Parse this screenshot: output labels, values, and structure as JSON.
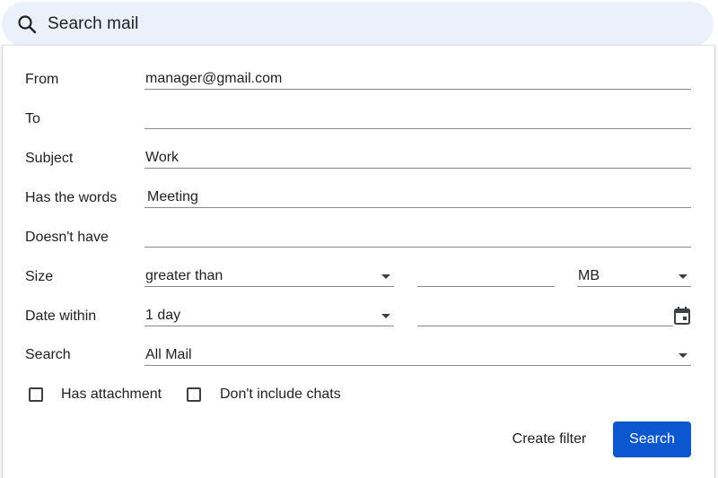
{
  "search": {
    "placeholder": "Search mail"
  },
  "form": {
    "from": {
      "label": "From",
      "value": "manager@gmail.com"
    },
    "to": {
      "label": "To",
      "value": ""
    },
    "subject": {
      "label": "Subject",
      "value": "Work"
    },
    "has_words": {
      "label": "Has the words",
      "value": "Meeting"
    },
    "doesnt_have": {
      "label": "Doesn't have",
      "value": ""
    },
    "size": {
      "label": "Size",
      "comparator": "greater than",
      "amount": "",
      "unit": "MB"
    },
    "date_within": {
      "label": "Date within",
      "value": "1 day",
      "date": ""
    },
    "search_in": {
      "label": "Search",
      "value": "All Mail"
    }
  },
  "checkboxes": {
    "has_attachment": {
      "label": "Has attachment",
      "checked": false
    },
    "no_chats": {
      "label": "Don't include chats",
      "checked": false
    }
  },
  "actions": {
    "create_filter": "Create filter",
    "search": "Search"
  },
  "colors": {
    "primary": "#0b57d0",
    "searchbar_bg": "#eaf1fb"
  },
  "icons": [
    "search-icon",
    "chevron-down-icon",
    "calendar-icon",
    "checkbox-icon"
  ]
}
